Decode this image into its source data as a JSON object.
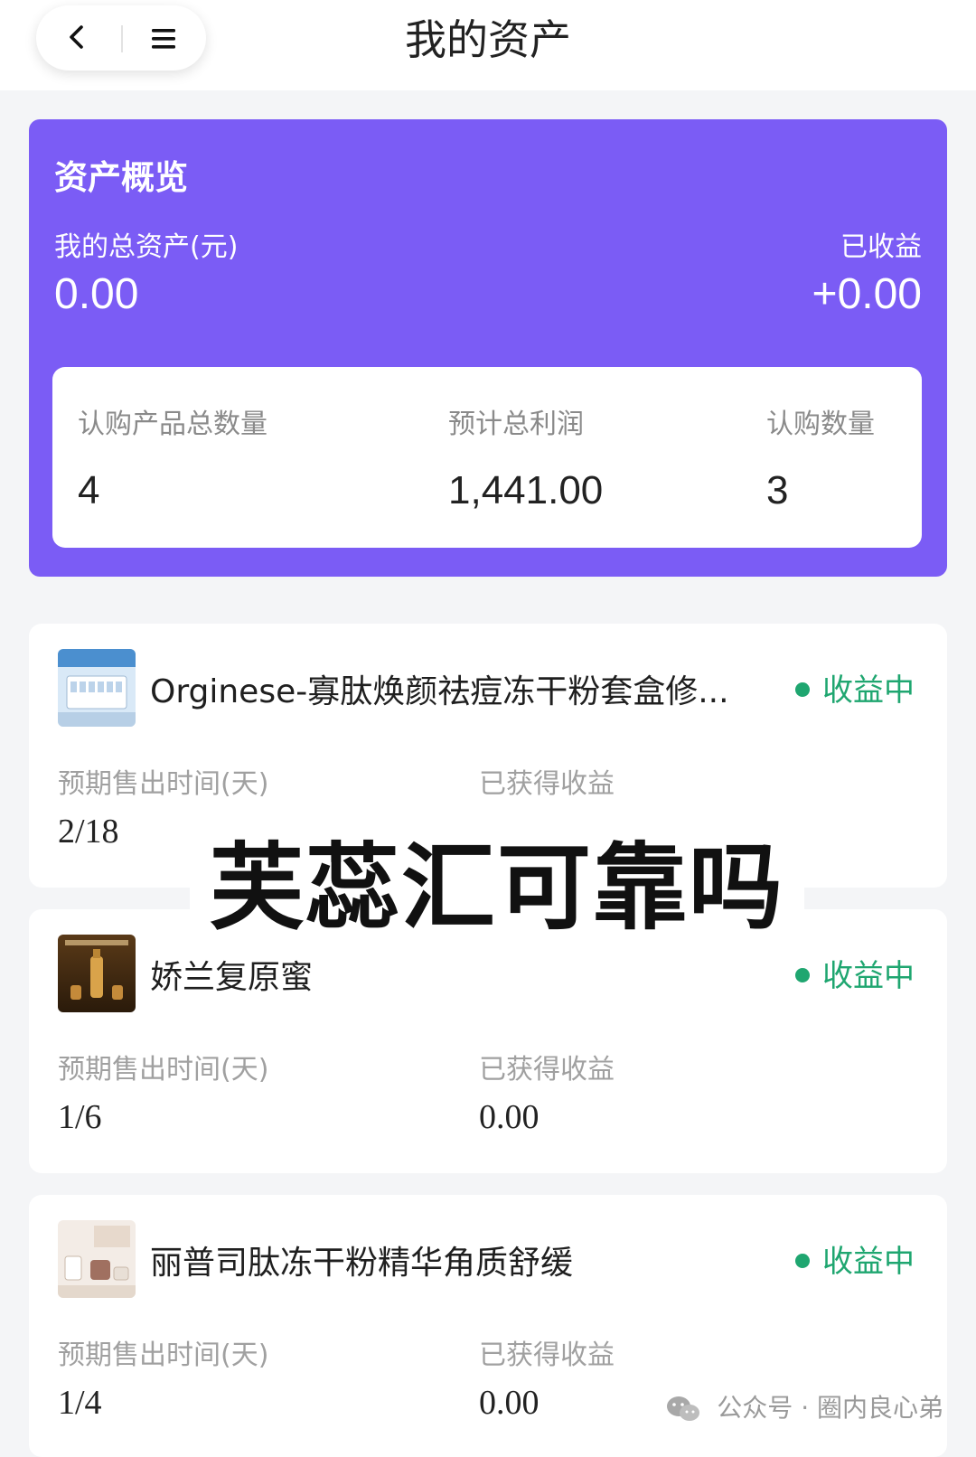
{
  "header": {
    "title": "我的资产",
    "back_icon": "chevron-left-icon",
    "menu_icon": "hamburger-menu-icon"
  },
  "overview": {
    "title": "资产概览",
    "total_assets_label": "我的总资产(元)",
    "total_assets_value": "0.00",
    "earned_label": "已收益",
    "earned_value": "+0.00",
    "stats": [
      {
        "label": "认购产品总数量",
        "value": "4"
      },
      {
        "label": "预计总利润",
        "value": "1,441.00"
      },
      {
        "label": "认购数量",
        "value": "3"
      }
    ],
    "accent_color": "#7b5cf5"
  },
  "products": [
    {
      "name": "Orginese-寡肽焕颜祛痘冻干粉套盒修...",
      "status": "收益中",
      "sell_time_label": "预期售出时间(天)",
      "sell_time_value": "2/18",
      "earned_label": "已获得收益",
      "earned_value": ""
    },
    {
      "name": "娇兰复原蜜",
      "status": "收益中",
      "sell_time_label": "预期售出时间(天)",
      "sell_time_value": "1/6",
      "earned_label": "已获得收益",
      "earned_value": "0.00"
    },
    {
      "name": "丽普司肽冻干粉精华角质舒缓",
      "status": "收益中",
      "sell_time_label": "预期售出时间(天)",
      "sell_time_value": "1/4",
      "earned_label": "已获得收益",
      "earned_value": "0.00"
    }
  ],
  "status_color": "#1fa670",
  "overlay_caption": "芙蕊汇可靠吗",
  "watermark": "公众号 · 圈内良心弟"
}
